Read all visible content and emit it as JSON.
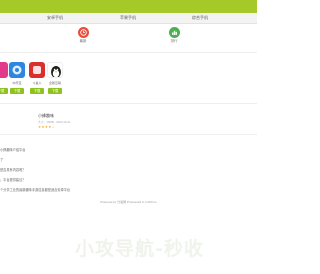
{
  "nav": {
    "items": [
      {
        "label": "安卓手机"
      },
      {
        "label": "苹果手机"
      },
      {
        "label": "综合手机"
      }
    ]
  },
  "categories": [
    {
      "label": "最新",
      "icon": "clock-icon",
      "color": "#e84c3d"
    },
    {
      "label": "排行",
      "icon": "ranking-icon",
      "color": "#4caf50"
    }
  ],
  "apps": [
    {
      "name": "",
      "icon": "app-icon-partial",
      "color": "#e23a8a",
      "button": "下载"
    },
    {
      "name": "中乐宝",
      "icon": "app-icon",
      "color": "#2e86de",
      "button": "下载"
    },
    {
      "name": "斗鱼人",
      "icon": "app-icon",
      "color": "#d9302f",
      "button": "下载"
    },
    {
      "name": "企鹅互联",
      "icon": "penguin-icon",
      "color": "#f7b500",
      "button": "下载"
    }
  ],
  "info": {
    "title": "小蜂趣味",
    "meta": "大小：19MB · 2020-10-21",
    "rating": 4,
    "stars": "★★★★☆"
  },
  "text_lines": [
    {
      "text": "小蜂趣味介绍平台"
    },
    {
      "text": "了"
    },
    {
      "text": "是否具有内容呢？"
    },
    {
      "text": "；平台提供建议？"
    },
    {
      "text": "个分享工业的最新趣味手游信息都是适合安卓平台"
    }
  ],
  "footer": {
    "text": "Powered by 分发网  Processed in 1.007ms"
  },
  "watermark": {
    "text": "小攻导航-秒收"
  }
}
